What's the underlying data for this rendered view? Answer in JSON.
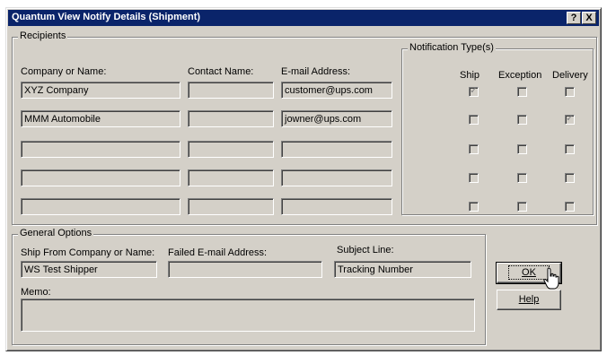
{
  "window": {
    "title": "Quantum View Notify Details (Shipment)",
    "help_button": "?",
    "close_button": "X"
  },
  "recipients": {
    "group_label": "Recipients",
    "columns": {
      "company": "Company or Name:",
      "contact": "Contact Name:",
      "email": "E-mail Address:"
    },
    "rows": [
      {
        "company": "XYZ Company",
        "contact": "",
        "email": "customer@ups.com"
      },
      {
        "company": "MMM Automobile",
        "contact": "",
        "email": "jowner@ups.com"
      },
      {
        "company": "",
        "contact": "",
        "email": ""
      },
      {
        "company": "",
        "contact": "",
        "email": ""
      },
      {
        "company": "",
        "contact": "",
        "email": ""
      }
    ]
  },
  "notification_types": {
    "group_label": "Notification Type(s)",
    "columns": [
      "Ship",
      "Exception",
      "Delivery"
    ],
    "checks": [
      [
        true,
        false,
        false
      ],
      [
        false,
        false,
        true
      ],
      [
        false,
        false,
        false
      ],
      [
        false,
        false,
        false
      ],
      [
        false,
        false,
        false
      ]
    ]
  },
  "general_options": {
    "group_label": "General Options",
    "ship_from_label": "Ship From Company or Name:",
    "ship_from_value": "WS Test Shipper",
    "failed_email_label": "Failed E-mail Address:",
    "failed_email_value": "",
    "subject_label": "Subject Line:",
    "subject_value": "Tracking Number",
    "memo_label": "Memo:",
    "memo_value": ""
  },
  "buttons": {
    "ok": "OK",
    "help": "Help"
  }
}
